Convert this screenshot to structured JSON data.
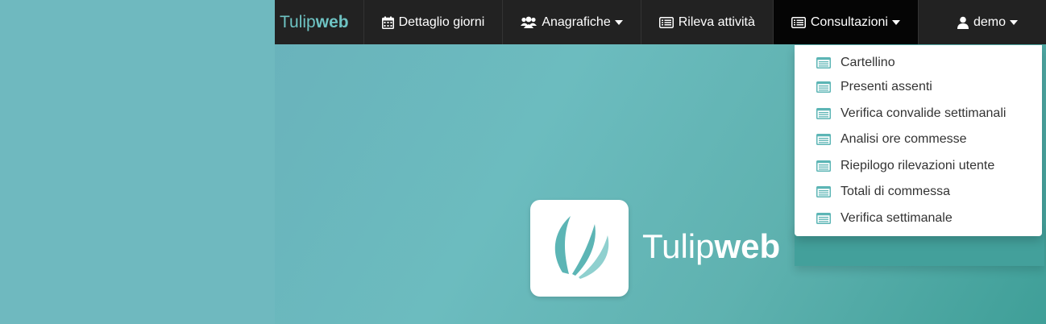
{
  "brand": {
    "prefix": "Tulip",
    "suffix": "web"
  },
  "nav": {
    "dettaglio_giorni": "Dettaglio giorni",
    "anagrafiche": "Anagrafiche",
    "rileva_attivita": "Rileva attività",
    "consultazioni": "Consultazioni",
    "user": "demo"
  },
  "dropdown": {
    "items": [
      {
        "label": "Cartellino"
      },
      {
        "label": "Presenti assenti"
      },
      {
        "label": "Verifica convalide settimanali"
      },
      {
        "label": "Analisi ore commesse"
      },
      {
        "label": "Riepilogo rilevazioni utente"
      },
      {
        "label": "Totali di commessa"
      },
      {
        "label": "Verifica settimanale"
      }
    ]
  },
  "hero": {
    "prefix": "Tulip",
    "suffix": "web"
  },
  "icons": {
    "dettaglio_giorni": "calendar-icon",
    "anagrafiche": "users-icon",
    "rileva_attivita": "list-icon",
    "consultazioni": "list-icon",
    "user": "user-icon",
    "dropdown_item": "list-alt-icon",
    "logo": "tulip-logo"
  },
  "colors": {
    "navbar": "#222222",
    "navbar_active": "#050505",
    "brand_accent": "#6ec3c3",
    "background": "#6cbcbf",
    "icon_teal": "#5cb5b5"
  }
}
